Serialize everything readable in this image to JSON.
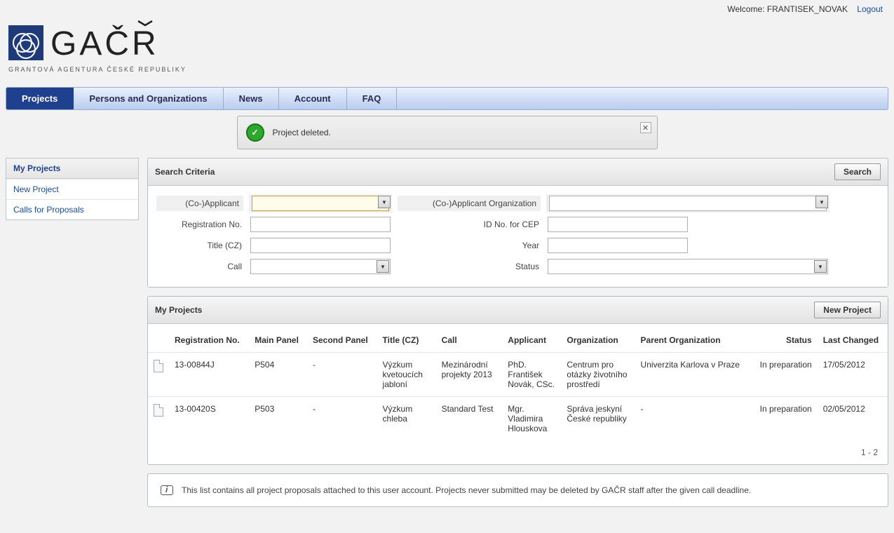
{
  "header": {
    "welcome_prefix": "Welcome: ",
    "username": "FRANTISEK_NOVAK",
    "logout": "Logout",
    "logo_title": "GAČR",
    "logo_sub": "GRANTOVÁ AGENTURA ČESKÉ REPUBLIKY"
  },
  "nav": {
    "projects": "Projects",
    "persons_orgs": "Persons and Organizations",
    "news": "News",
    "account": "Account",
    "faq": "FAQ"
  },
  "alert": {
    "message": "Project deleted."
  },
  "sidebar": {
    "my_projects": "My Projects",
    "new_project": "New Project",
    "calls": "Calls for Proposals"
  },
  "search_panel": {
    "title": "Search Criteria",
    "search_btn": "Search",
    "labels": {
      "co_applicant": "(Co-)Applicant",
      "co_applicant_org": "(Co-)Applicant Organization",
      "reg_no": "Registration No.",
      "id_cep": "ID No. for CEP",
      "title_cz": "Title (CZ)",
      "year": "Year",
      "call": "Call",
      "status": "Status"
    },
    "values": {
      "co_applicant": "",
      "co_applicant_org": "",
      "reg_no": "",
      "id_cep": "",
      "title_cz": "",
      "year": "",
      "call": "",
      "status": ""
    }
  },
  "projects_panel": {
    "title": "My Projects",
    "new_project_btn": "New Project",
    "columns": {
      "reg_no": "Registration No.",
      "main_panel": "Main Panel",
      "second_panel": "Second Panel",
      "title_cz": "Title (CZ)",
      "call": "Call",
      "applicant": "Applicant",
      "organization": "Organization",
      "parent_org": "Parent Organization",
      "status": "Status",
      "last_changed": "Last Changed"
    },
    "rows": [
      {
        "reg_no": "13-00844J",
        "main_panel": "P504",
        "second_panel": "-",
        "title_cz": "Výzkum kvetoucích jabloní",
        "call": "Mezinárodní projekty 2013",
        "applicant": "PhD. František Novák, CSc.",
        "organization": "Centrum pro otázky životního prostředí",
        "parent_org": "Univerzita Karlova v Praze",
        "status": "In preparation",
        "last_changed": "17/05/2012"
      },
      {
        "reg_no": "13-00420S",
        "main_panel": "P503",
        "second_panel": "-",
        "title_cz": "Výzkum chleba",
        "call": "Standard Test",
        "applicant": "Mgr. Vladimira Hlouskova",
        "organization": "Správa jeskyní České republiky",
        "parent_org": "-",
        "status": "In preparation",
        "last_changed": "02/05/2012"
      }
    ],
    "pager": "1 - 2"
  },
  "footer_info": "This list contains all project proposals attached to this user account. Projects never submitted may be deleted by GAČR staff after the given call deadline."
}
